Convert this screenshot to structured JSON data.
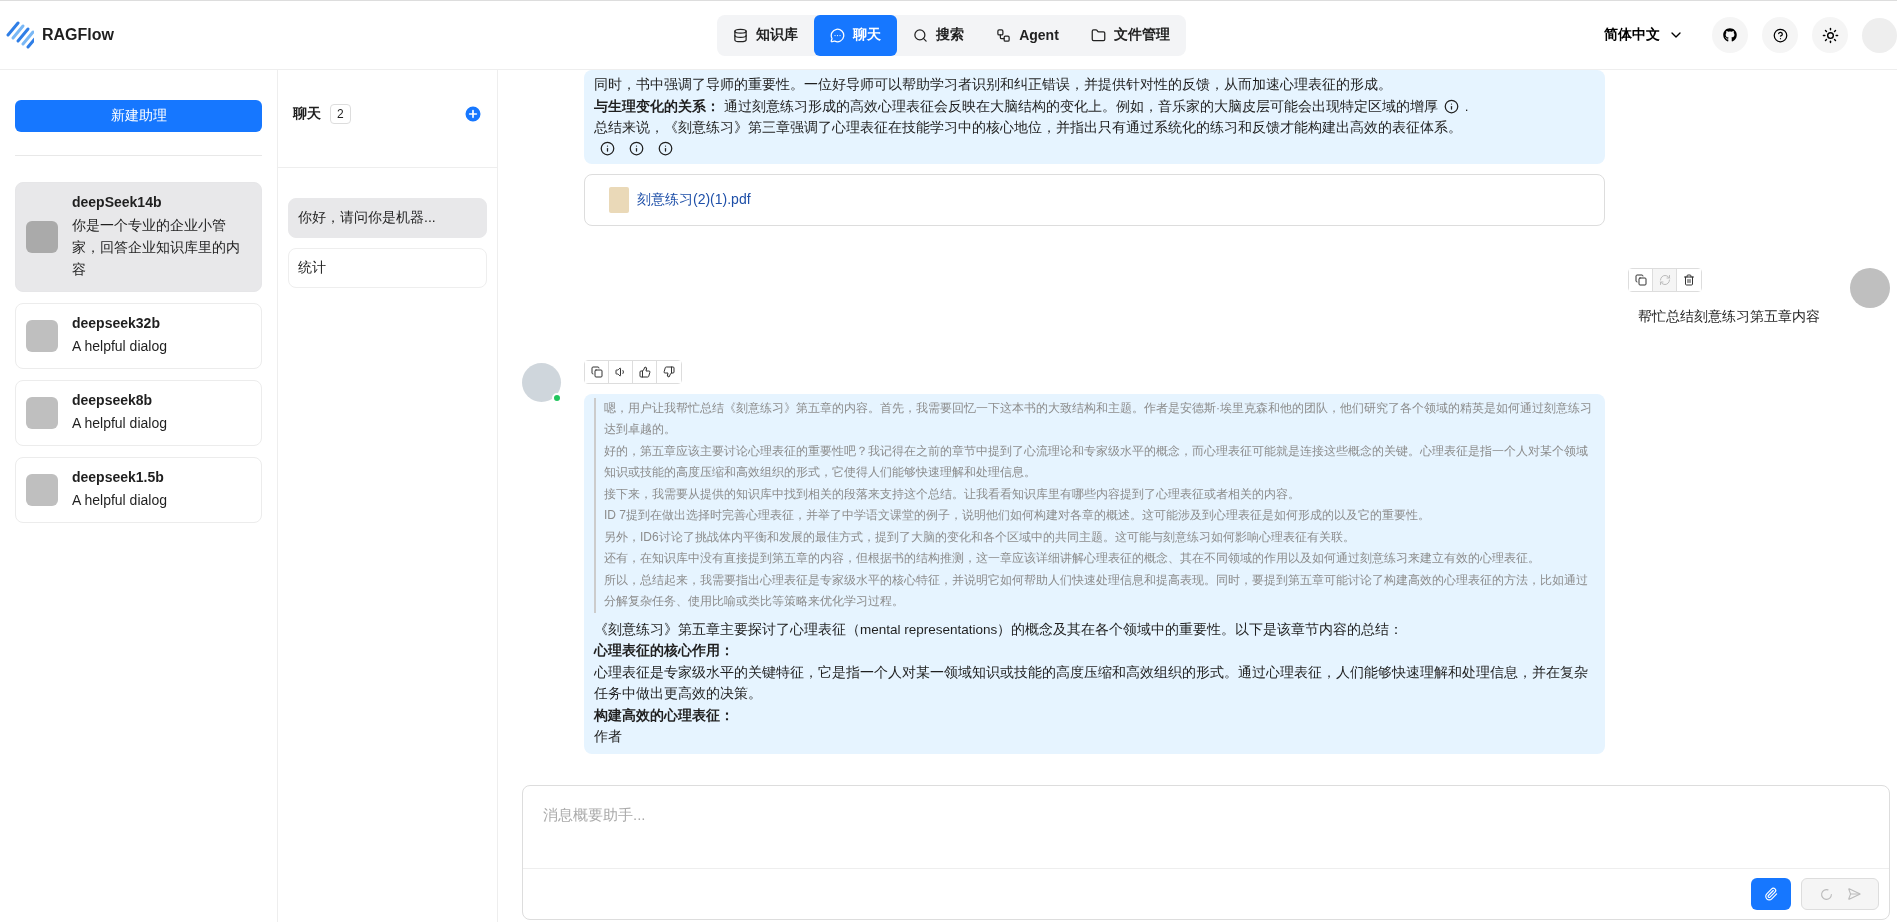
{
  "header": {
    "logo_text": "RAGFlow",
    "nav": [
      {
        "label": "知识库",
        "selected": false
      },
      {
        "label": "聊天",
        "selected": true
      },
      {
        "label": "搜索",
        "selected": false
      },
      {
        "label": "Agent",
        "selected": false
      },
      {
        "label": "文件管理",
        "selected": false
      }
    ],
    "language": "简体中文"
  },
  "assistants": {
    "new_button": "新建助理",
    "items": [
      {
        "name": "deepSeek14b",
        "description": "你是一个专业的企业小管家，回答企业知识库里的内容",
        "selected": true
      },
      {
        "name": "deepseek32b",
        "description": "A helpful dialog",
        "selected": false
      },
      {
        "name": "deepseek8b",
        "description": "A helpful dialog",
        "selected": false
      },
      {
        "name": "deepseek1.5b",
        "description": "A helpful dialog",
        "selected": false
      }
    ]
  },
  "chats": {
    "title": "聊天",
    "count": "2",
    "items": [
      {
        "title": "你好，请问你是机器...",
        "selected": true
      },
      {
        "title": "统计",
        "selected": false
      }
    ]
  },
  "messages": [
    {
      "kind": "answer",
      "lines": [
        {
          "text": "同时，书中强调了导师的重要性。一位好导师可以帮助学习者识别和纠正错误，并提供针对性的反馈，从而加速心理表征的形成。",
          "cited": false
        },
        {
          "text": "**与生理变化的关系：** 通过刻意练习形成的高效心理表征会反映在大脑结构的变化上。例如，音乐家的大脑皮层可能会出现特定区域的增厚",
          "cited": true,
          "tail": "."
        },
        {
          "text": "总结来说，《刻意练习》第三章强调了心理表征在技能学习中的核心地位，并指出只有通过系统化的练习和反馈才能构建出高效的表征体系。",
          "cited": false
        }
      ],
      "citation_row": true,
      "documents": [
        {
          "name": "刻意练习(2)(1).pdf"
        }
      ]
    },
    {
      "kind": "question",
      "text": "帮忙总结刻意练习第五章内容"
    },
    {
      "kind": "thinking",
      "online": true,
      "think": [
        "嗯，用户让我帮忙总结《刻意练习》第五章的内容。首先，我需要回忆一下这本书的大致结构和主题。作者是安德斯·埃里克森和他的团队，他们研究了各个领域的精英是如何通过刻意练习达到卓越的。",
        "好的，第五章应该主要讨论心理表征的重要性吧？我记得在之前的章节中提到了心流理论和专家级水平的概念，而心理表征可能就是连接这些概念的关键。心理表征是指一个人对某个领域知识或技能的高度压缩和高效组织的形式，它使得人们能够快速理解和处理信息。",
        "接下来，我需要从提供的知识库中找到相关的段落来支持这个总结。让我看看知识库里有哪些内容提到了心理表征或者相关的内容。",
        "ID 7提到在做出选择时完善心理表征，并举了中学语文课堂的例子，说明他们如何构建对各章的概述。这可能涉及到心理表征是如何形成的以及它的重要性。",
        "另外，ID6讨论了挑战体内平衡和发展的最佳方式，提到了大脑的变化和各个区域中的共同主题。这可能与刻意练习如何影响心理表征有关联。",
        "还有，在知识库中没有直接提到第五章的内容，但根据书的结构推测，这一章应该详细讲解心理表征的概念、其在不同领域的作用以及如何通过刻意练习来建立有效的心理表征。",
        "所以，总结起来，我需要指出心理表征是专家级水平的核心特征，并说明它如何帮助人们快速处理信息和提高表现。同时，要提到第五章可能讨论了构建高效的心理表征的方法，比如通过分解复杂任务、使用比喻或类比等策略来优化学习过程。"
      ],
      "lines": [
        {
          "text": "《刻意练习》第五章主要探讨了心理表征（mental representations）的概念及其在各个领域中的重要性。以下是该章节内容的总结：",
          "bold": false
        },
        {
          "text": "心理表征的核心作用：",
          "bold": true
        },
        {
          "text": "心理表征是专家级水平的关键特征，它是指一个人对某一领域知识或技能的高度压缩和高效组织的形式。通过心理表征，人们能够快速理解和处理信息，并在复杂任务中做出更高效的决策。",
          "bold": false
        },
        {
          "text": "构建高效的心理表征：",
          "bold": true
        },
        {
          "text": "作者",
          "bold": false
        }
      ]
    }
  ],
  "composer": {
    "placeholder": "消息概要助手...",
    "send_disabled": true
  }
}
